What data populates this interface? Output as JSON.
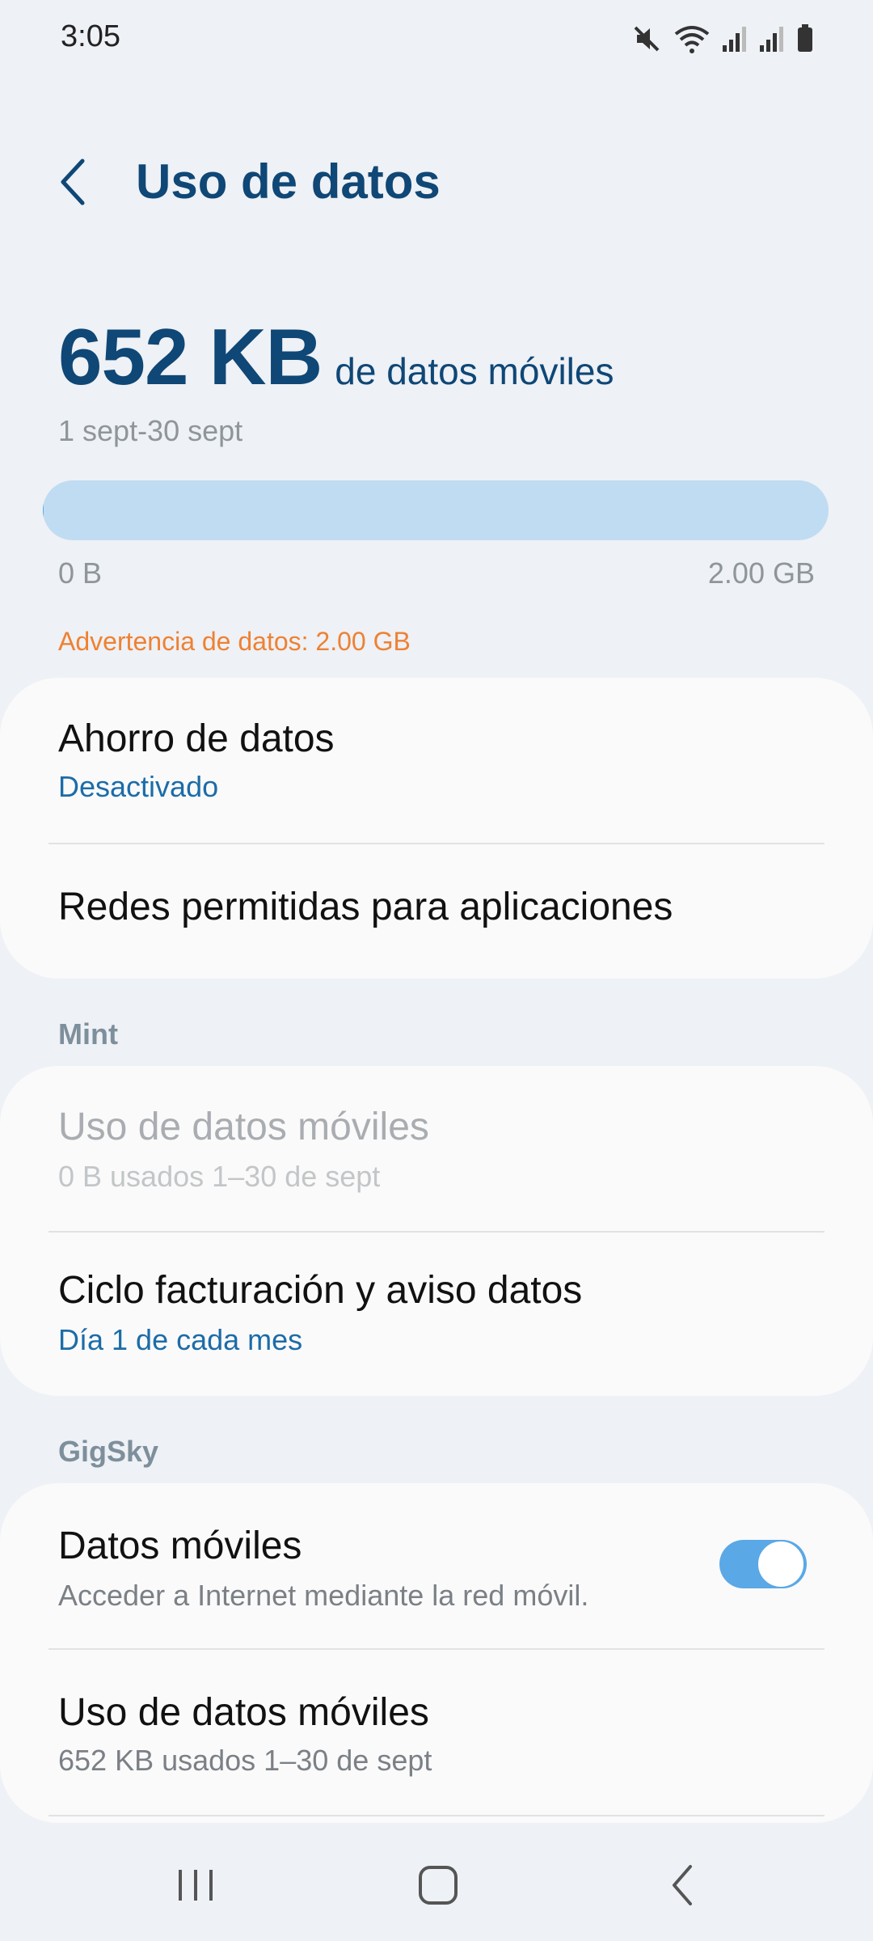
{
  "status_bar": {
    "time": "3:05",
    "icons": [
      "mute-icon",
      "wifi-icon",
      "signal-icon",
      "signal-icon",
      "battery-icon"
    ]
  },
  "header": {
    "title": "Uso de datos",
    "back_icon": "back-arrow-icon"
  },
  "usage": {
    "amount": "652 KB",
    "unit_label": "de datos móviles",
    "period": "1 sept-30 sept",
    "bar_fraction": 0.0003,
    "bar_min": "0 B",
    "bar_max": "2.00 GB",
    "warning": "Advertencia de datos: 2.00 GB",
    "warning_color": "#ee8133"
  },
  "card1": {
    "data_saver_title": "Ahorro de datos",
    "data_saver_status": "Desactivado",
    "allowed_networks_title": "Redes permitidas para aplicaciones"
  },
  "section_mint": {
    "header": "Mint",
    "mobile_usage_title": "Uso de datos móviles",
    "mobile_usage_sub": "0 B usados 1–30 de sept",
    "billing_title": "Ciclo facturación y aviso datos",
    "billing_sub": "Día 1 de cada mes"
  },
  "section_gigsky": {
    "header": "GigSky",
    "mobile_data_title": "Datos móviles",
    "mobile_data_sub": "Acceder a Internet mediante la red móvil.",
    "mobile_data_enabled": true,
    "mobile_usage_title": "Uso de datos móviles",
    "mobile_usage_sub": "652 KB usados 1–30 de sept"
  },
  "nav": {
    "recents_icon": "recents-icon",
    "home_icon": "home-icon",
    "back_icon": "back-icon"
  },
  "colors": {
    "accent": "#0f4776",
    "link": "#1c6ca8",
    "toggle_on": "#5aa8e6"
  }
}
